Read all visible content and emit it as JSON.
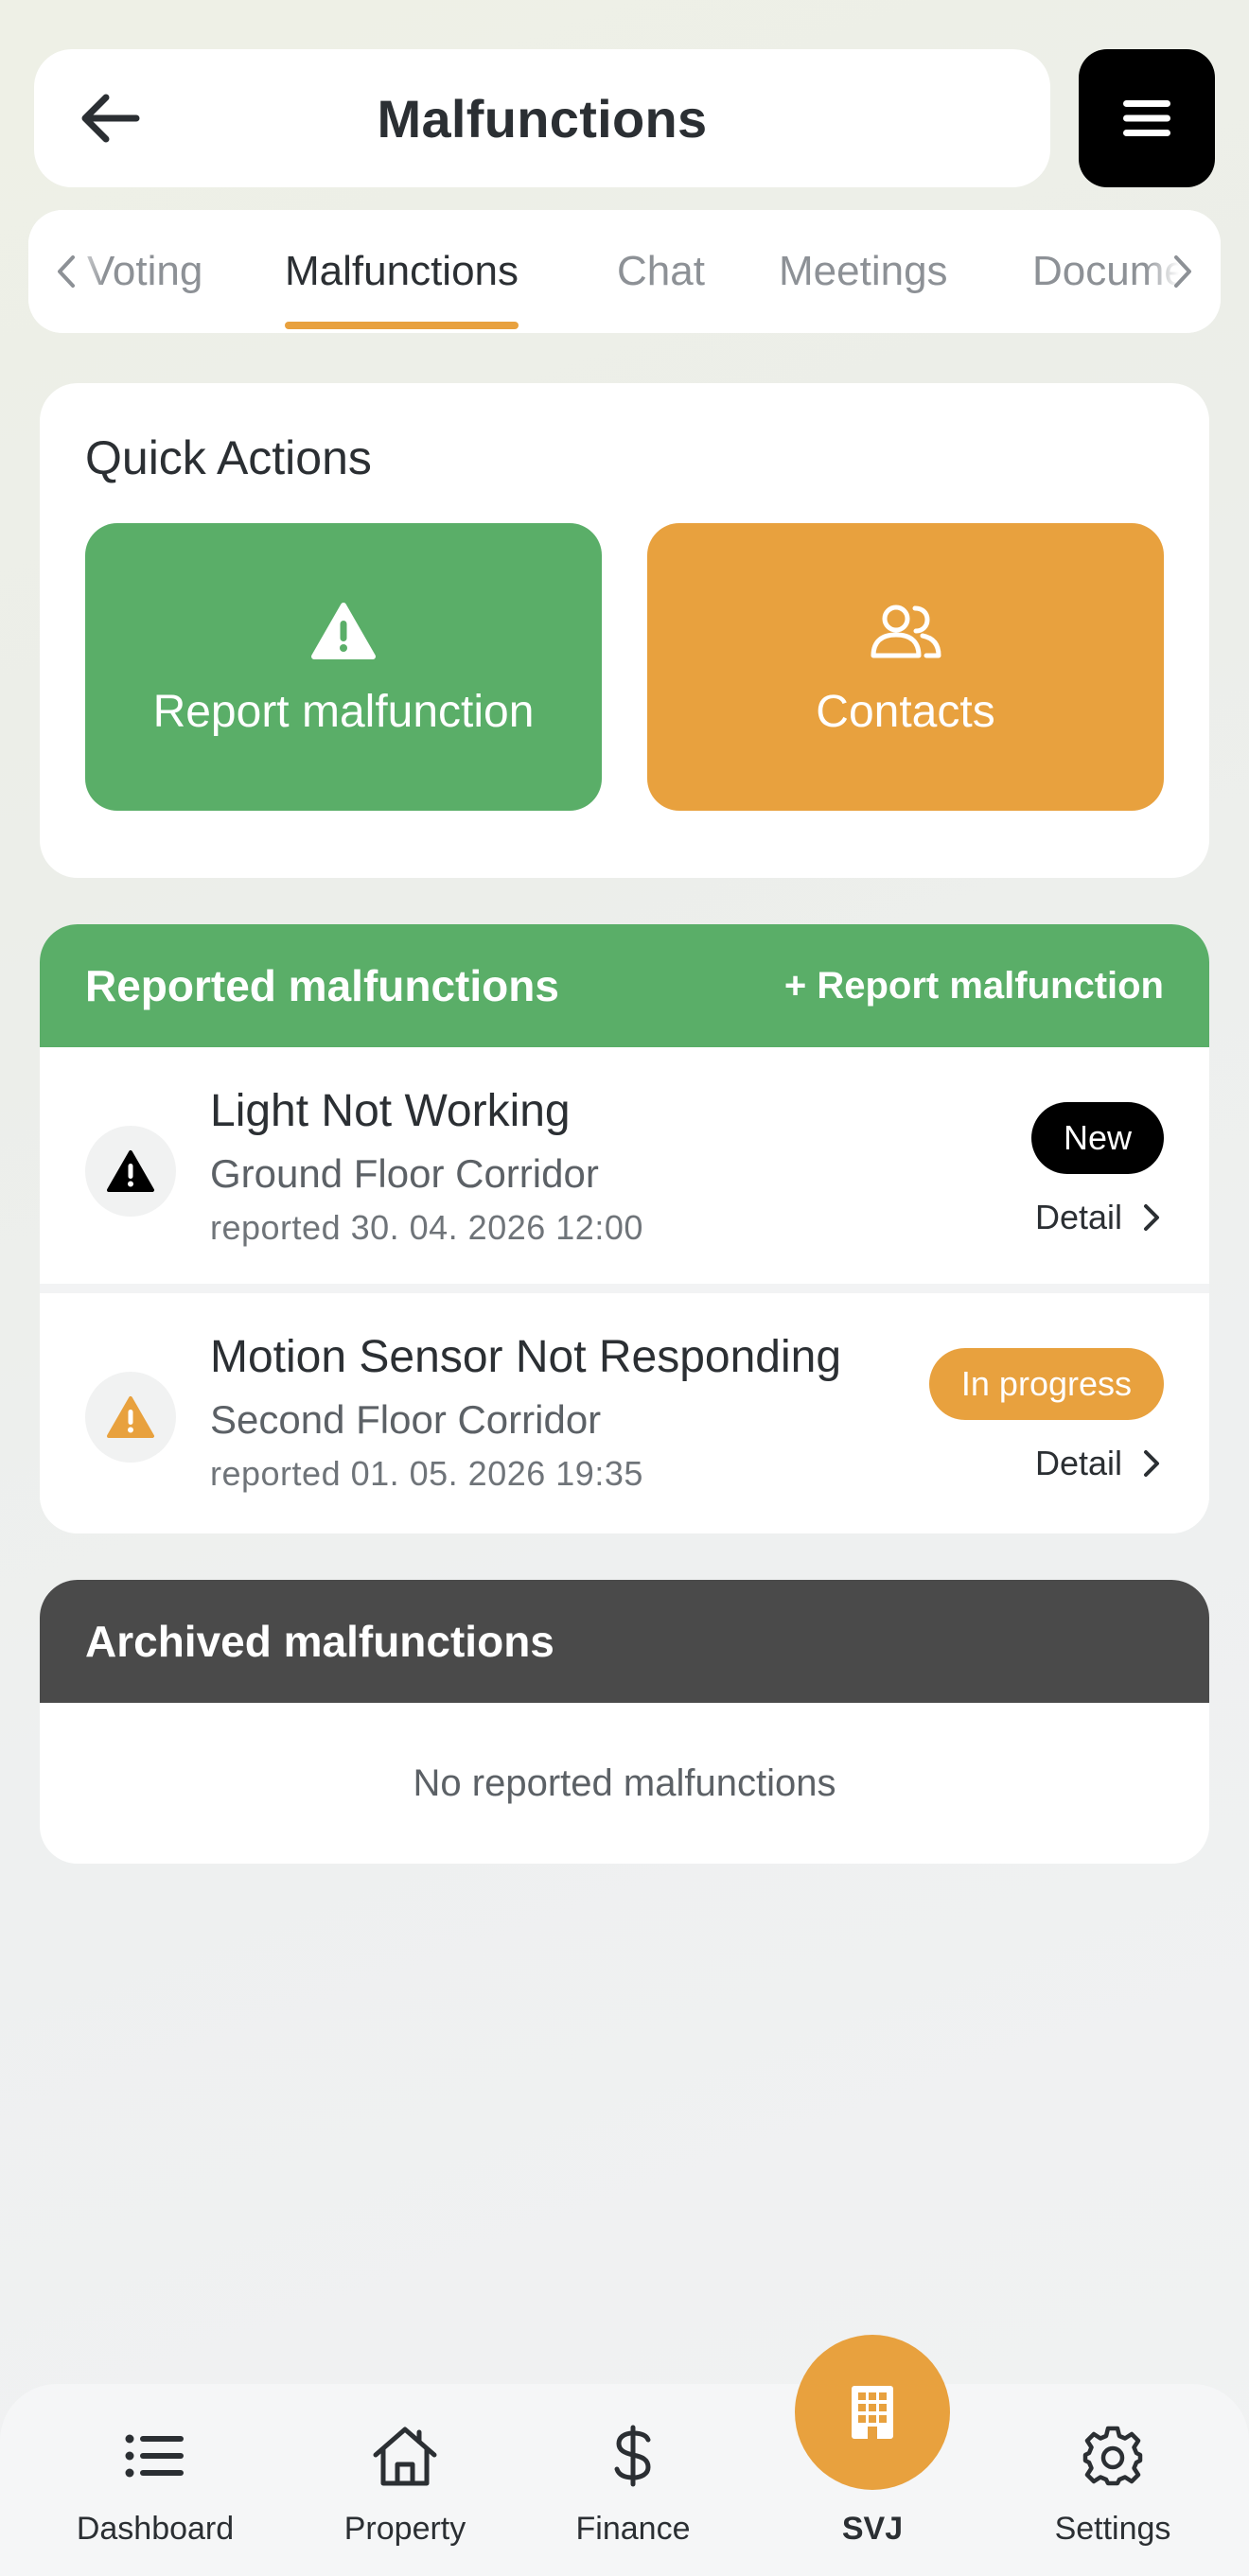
{
  "header": {
    "title": "Malfunctions"
  },
  "tabs": {
    "items": [
      {
        "label": "Voting"
      },
      {
        "label": "Malfunctions"
      },
      {
        "label": "Chat"
      },
      {
        "label": "Meetings"
      },
      {
        "label": "Documents"
      }
    ],
    "active_index": 1
  },
  "quick_actions": {
    "title": "Quick Actions",
    "report_label": "Report malfunction",
    "contacts_label": "Contacts"
  },
  "reported": {
    "title": "Reported malfunctions",
    "add_link": "+ Report malfunction",
    "items": [
      {
        "title": "Light Not Working",
        "location": "Ground Floor Corridor",
        "date": "reported 30. 04. 2026 12:00",
        "status": "New",
        "detail": "Detail"
      },
      {
        "title": "Motion Sensor Not Responding",
        "location": "Second Floor Corridor",
        "date": "reported 01. 05. 2026 19:35",
        "status": "In progress",
        "detail": "Detail"
      }
    ]
  },
  "archived": {
    "title": "Archived malfunctions",
    "empty_text": "No reported malfunctions"
  },
  "bottom_nav": {
    "items": [
      {
        "label": "Dashboard",
        "icon": "list-icon"
      },
      {
        "label": "Property",
        "icon": "house-icon"
      },
      {
        "label": "Finance",
        "icon": "dollar-icon"
      },
      {
        "label": "SVJ",
        "icon": "building-icon"
      },
      {
        "label": "Settings",
        "icon": "gear-icon"
      }
    ]
  },
  "colors": {
    "green": "#5aae68",
    "orange": "#e8a13e",
    "dark_header": "#4a4a4a",
    "text": "#2b2f33"
  }
}
